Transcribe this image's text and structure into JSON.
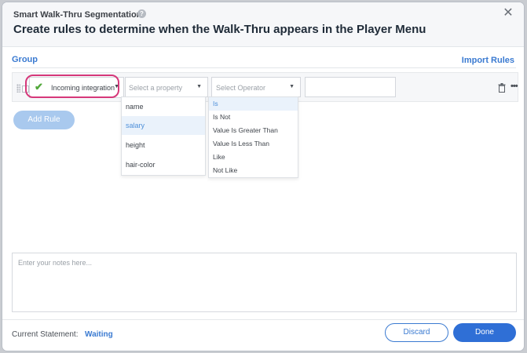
{
  "header": {
    "subtitle": "Smart Walk-Thru Segmentation",
    "title": "Create rules to determine when the Walk-Thru appears in the Player Menu",
    "help_icon": "question-circle-icon",
    "close_icon": "close-icon",
    "help_glyph": "?",
    "close_glyph": "✕"
  },
  "group": {
    "label": "Group",
    "import_label": "Import Rules"
  },
  "rule": {
    "integration_value": "Incoming integration",
    "property_placeholder": "Select a property",
    "operator_placeholder": "Select Operator",
    "value": "",
    "check_icon": "checkmark-icon",
    "trash_icon": "trash-icon",
    "more_icon": "more-horizontal-icon",
    "more_glyph": "•••",
    "caret_glyph": "▼"
  },
  "add_rule_label": "Add Rule",
  "property_options": [
    "name",
    "salary",
    "height",
    "hair-color"
  ],
  "property_selected": "salary",
  "operator_options": [
    "Is",
    "Is Not",
    "Value Is Greater Than",
    "Value Is Less Than",
    "Like",
    "Not Like"
  ],
  "operator_selected": "Is",
  "notes": {
    "placeholder": "Enter your notes here...",
    "value": ""
  },
  "footer": {
    "statement_label": "Current Statement:",
    "statement_status": "Waiting",
    "discard_label": "Discard",
    "done_label": "Done"
  },
  "colors": {
    "accent": "#3a7ad1",
    "done_button": "#2f6fd6",
    "add_rule_button": "#a9c9ee",
    "highlight": "#d6387a",
    "check": "#52a83b"
  }
}
